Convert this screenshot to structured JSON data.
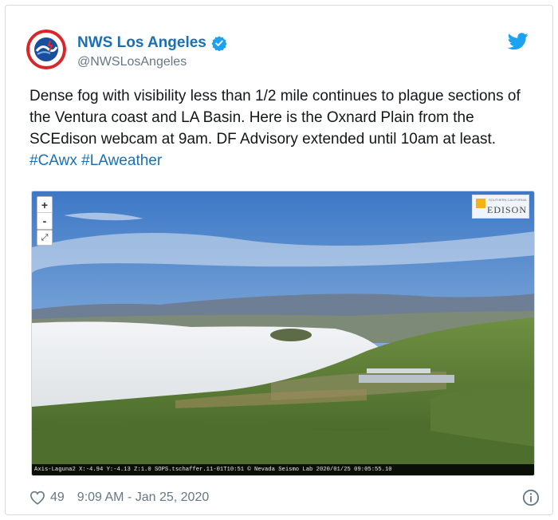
{
  "author": {
    "name": "NWS Los Angeles",
    "handle": "@NWSLosAngeles",
    "avatar_text": "NATIONAL WEATHER SERVICE"
  },
  "tweet": {
    "text": "Dense fog with visibility less than 1/2 mile continues to plague sections of the Ventura coast and LA Basin. Here is the Oxnard Plain from the SCEdison webcam at 9am. DF Advisory extended until 10am at least.",
    "hashtags": [
      "#CAwx",
      "#LAweather"
    ]
  },
  "media": {
    "zoom_in_label": "+",
    "zoom_out_label": "-",
    "fullscreen_label": "⤢",
    "logo_brand": "EDISON",
    "logo_tagline": "SOUTHERN CALIFORNIA",
    "caption": "Axis-Laguna2 X:-4.94 Y:-4.13 Z:1.0 SOPS.tschaffer.11-01T10:51 © Nevada Seismo Lab 2020/01/25 09:05:55.10"
  },
  "footer": {
    "likes": "49",
    "timestamp": "9:09 AM - Jan 25, 2020"
  },
  "colors": {
    "accent": "#1b6fb5",
    "text": "#14171a",
    "muted": "#657786",
    "twitter_blue": "#1da1f2"
  },
  "icons": {
    "verified": "verified-badge-icon",
    "bird": "twitter-bird-icon",
    "like": "heart-icon",
    "info": "info-icon"
  }
}
